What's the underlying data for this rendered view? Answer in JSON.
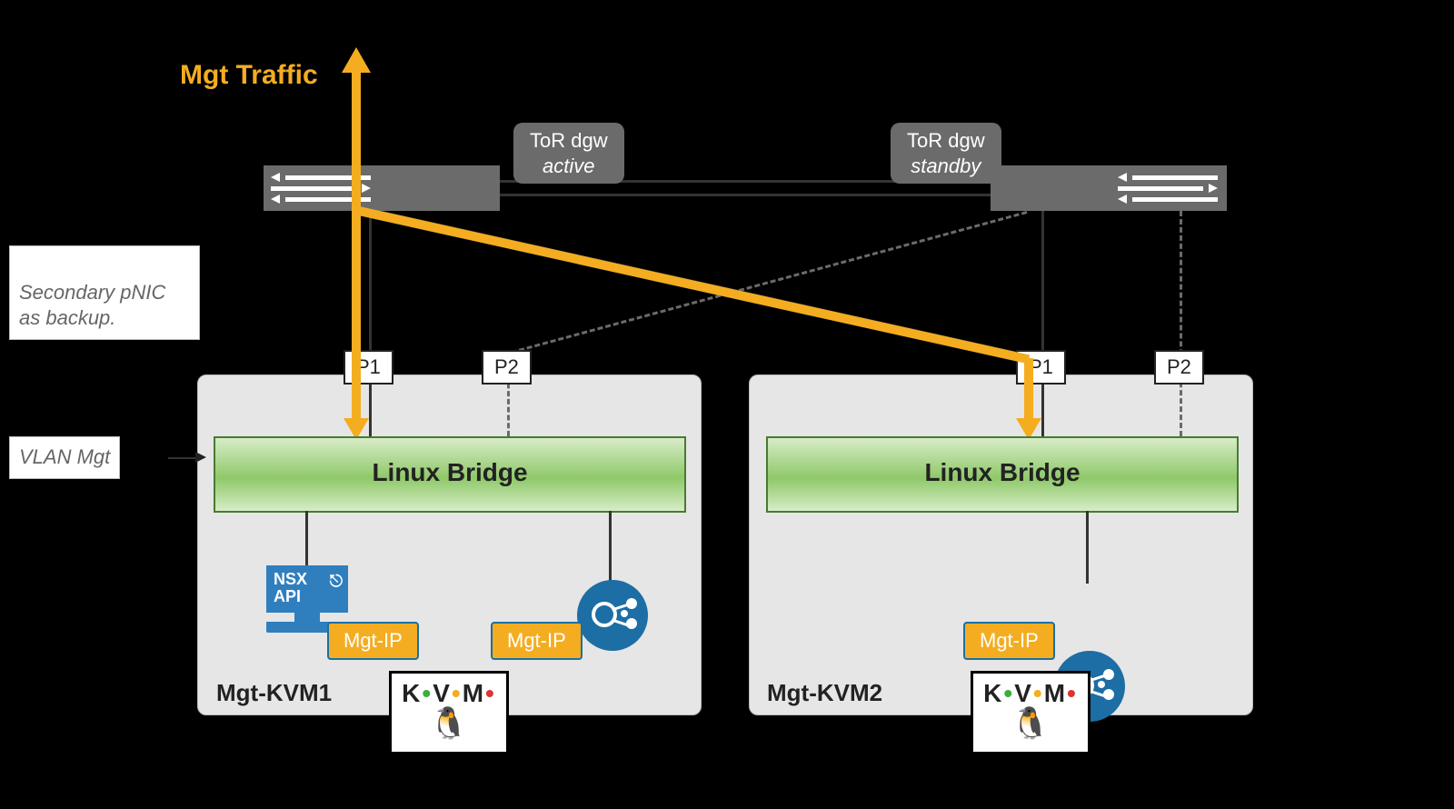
{
  "labels": {
    "mgt_traffic": "Mgt Traffic",
    "secondary_pnic": "Secondary pNIC\nas backup.",
    "vlan_mgt": "VLAN Mgt"
  },
  "tor": {
    "left_label_line1": "ToR dgw",
    "left_label_line2": "active",
    "right_label_line1": "ToR dgw",
    "right_label_line2": "standby"
  },
  "ports": {
    "p1": "P1",
    "p2": "P2"
  },
  "bridge": {
    "title": "Linux Bridge"
  },
  "hosts": {
    "left": {
      "name": "Mgt-KVM1"
    },
    "right": {
      "name": "Mgt-KVM2"
    }
  },
  "device": {
    "nsx_api": "NSX\nAPI",
    "mgt_ip": "Mgt-IP"
  },
  "logo": {
    "kvm": "KVM"
  }
}
